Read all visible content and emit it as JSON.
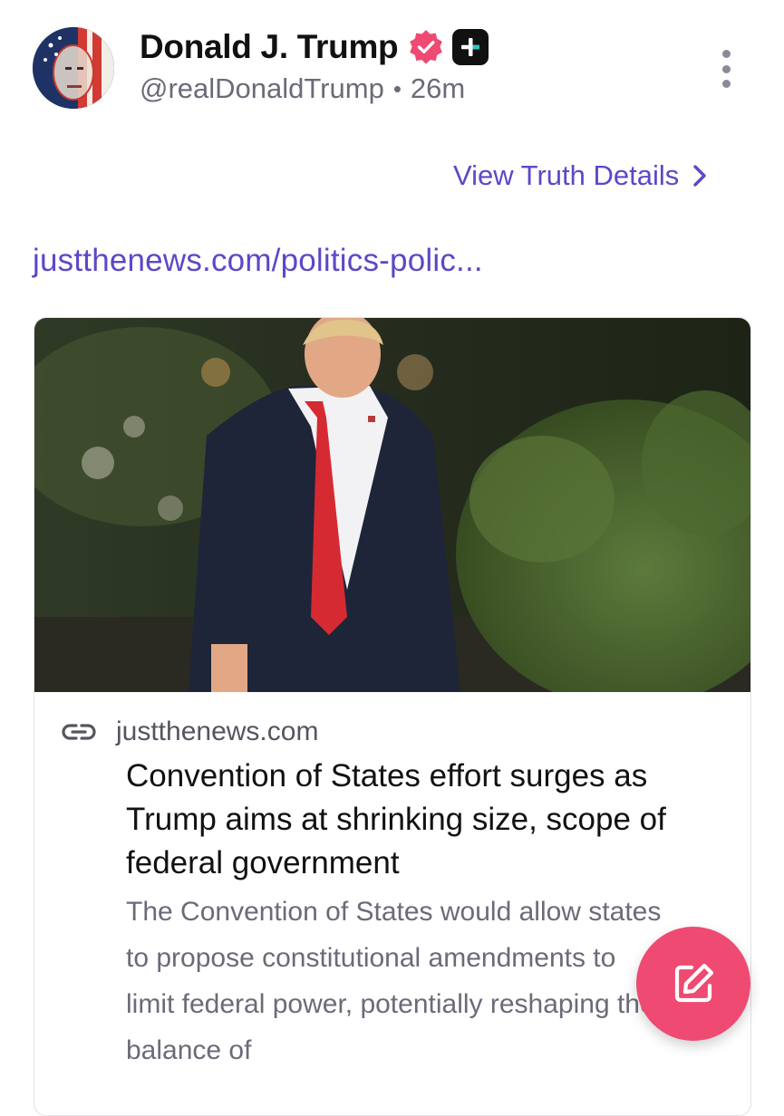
{
  "post": {
    "display_name": "Donald J. Trump",
    "handle": "@realDonaldTrump",
    "separator": "•",
    "time_ago": "26m",
    "view_details_label": "View Truth Details",
    "link_text": "justthenews.com/politics-polic..."
  },
  "card": {
    "domain": "justthenews.com",
    "title": "Convention of States effort surges as Trump aims at shrinking size, scope of federal government",
    "description": "The Convention of States would allow states to propose constitutional amendments to limit federal power, potentially reshaping the balance of"
  },
  "icons": {
    "verified": "verified-badge-icon",
    "plus": "plus-badge-icon",
    "more": "more-vertical-icon",
    "chevron": "chevron-right-icon",
    "link": "link-icon",
    "compose": "compose-icon"
  },
  "colors": {
    "accent": "#5c48c7",
    "fab": "#ee4a72",
    "verified": "#ee4a72"
  }
}
